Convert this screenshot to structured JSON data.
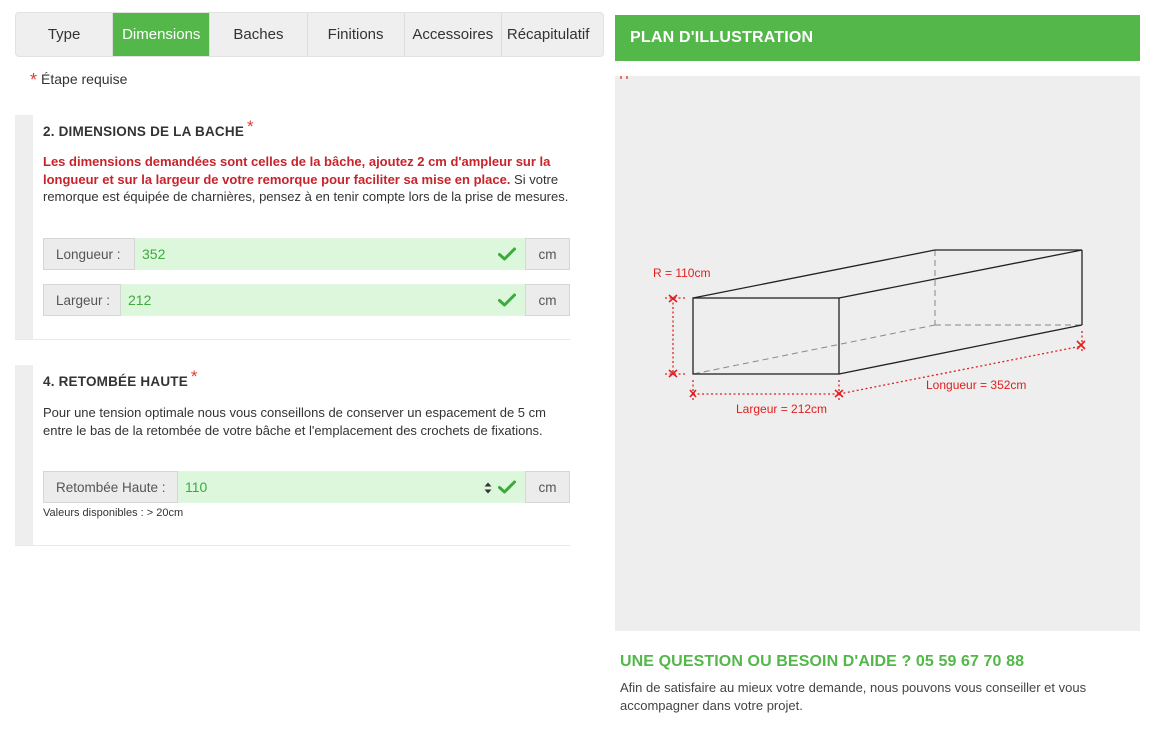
{
  "tabs": [
    {
      "label": "Type"
    },
    {
      "label": "Dimensions"
    },
    {
      "label": "Baches"
    },
    {
      "label": "Finitions"
    },
    {
      "label": "Accessoires"
    },
    {
      "label": "Récapitulatif"
    }
  ],
  "active_tab": "Dimensions",
  "required_note": {
    "star": "*",
    "text": "Étape requise"
  },
  "section_dimensions": {
    "title": "2. DIMENSIONS DE LA BACHE",
    "star": "*",
    "desc_red": "Les dimensions demandées sont celles de la bâche, ajoutez 2 cm d'ampleur sur la longueur et sur la largeur de votre remorque pour faciliter sa mise en place.",
    "desc_rest": " Si votre remorque est équipée de charnières, pensez à en tenir compte lors de la prise de mesures.",
    "longueur": {
      "label": "Longueur :",
      "value": "352",
      "unit": "cm"
    },
    "largeur": {
      "label": "Largeur :",
      "value": "212",
      "unit": "cm"
    }
  },
  "section_retombee": {
    "title": "4. RETOMBÉE HAUTE",
    "star": "*",
    "desc": "Pour une tension optimale nous vous conseillons de conserver un espacement de 5 cm entre le bas de la retombée de votre bâche et l'emplacement des crochets de fixations.",
    "retombee": {
      "label": "Retombée Haute :",
      "value": "110",
      "unit": "cm"
    },
    "hint": "Valeurs disponibles : > 20cm"
  },
  "panel": {
    "header": "PLAN D'ILLUSTRATION",
    "dim_r": "R = 110cm",
    "dim_longueur": "Longueur = 352cm",
    "dim_largeur": "Largeur = 212cm"
  },
  "help": {
    "title": "UNE QUESTION OU BESOIN D'AIDE ? 05 59 67 70 88",
    "text": "Afin de satisfaire au mieux votre demande, nous pouvons vous conseiller et vous accompagner dans votre projet."
  },
  "colors": {
    "brand_green": "#53b74a",
    "input_bg": "#dcf7dc",
    "required_red": "#e23a3a",
    "dimension_red": "#e02020"
  },
  "icons": [
    "check-icon",
    "spinner-icon"
  ]
}
